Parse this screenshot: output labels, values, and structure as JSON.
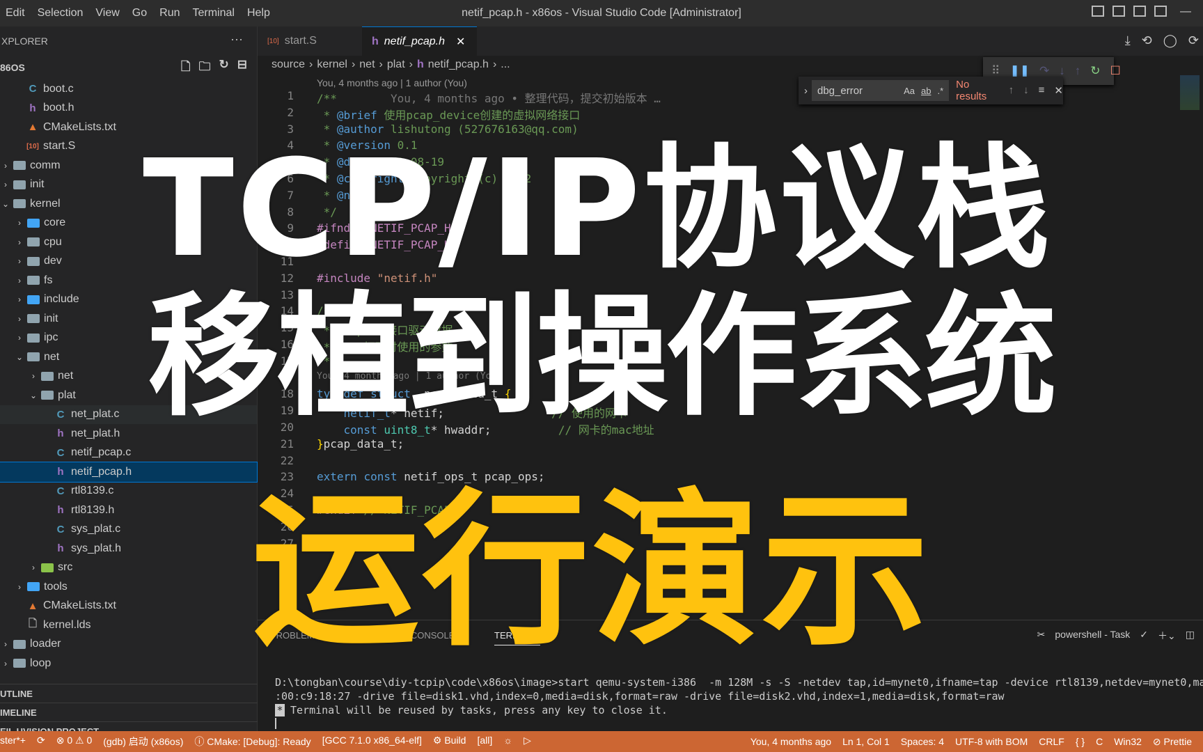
{
  "window": {
    "title": "netif_pcap.h - x86os - Visual Studio Code [Administrator]",
    "menu": [
      "Edit",
      "Selection",
      "View",
      "Go",
      "Run",
      "Terminal",
      "Help"
    ]
  },
  "sidebar": {
    "header": "XPLORER",
    "project": "86OS",
    "items": [
      {
        "label": "boot.c",
        "icon": "c-file-icon",
        "depth": 1
      },
      {
        "label": "boot.h",
        "icon": "h-file-icon",
        "depth": 1
      },
      {
        "label": "CMakeLists.txt",
        "icon": "cmake-icon",
        "depth": 1
      },
      {
        "label": "start.S",
        "icon": "asm-file-icon",
        "depth": 1
      },
      {
        "label": "comm",
        "icon": "folder-icon",
        "depth": 0,
        "chev": "›"
      },
      {
        "label": "init",
        "icon": "folder-icon",
        "depth": 0,
        "chev": "›"
      },
      {
        "label": "kernel",
        "icon": "folder-open-icon",
        "depth": 0,
        "chev": "⌄"
      },
      {
        "label": "core",
        "icon": "folder-blue-icon",
        "depth": 1,
        "chev": "›"
      },
      {
        "label": "cpu",
        "icon": "folder-icon",
        "depth": 1,
        "chev": "›"
      },
      {
        "label": "dev",
        "icon": "folder-icon",
        "depth": 1,
        "chev": "›"
      },
      {
        "label": "fs",
        "icon": "folder-icon",
        "depth": 1,
        "chev": "›"
      },
      {
        "label": "include",
        "icon": "folder-blue-icon",
        "depth": 1,
        "chev": "›"
      },
      {
        "label": "init",
        "icon": "folder-icon",
        "depth": 1,
        "chev": "›"
      },
      {
        "label": "ipc",
        "icon": "folder-icon",
        "depth": 1,
        "chev": "›"
      },
      {
        "label": "net",
        "icon": "folder-open-icon",
        "depth": 1,
        "chev": "⌄"
      },
      {
        "label": "net",
        "icon": "folder-icon",
        "depth": 2,
        "chev": "›"
      },
      {
        "label": "plat",
        "icon": "folder-open-icon",
        "depth": 2,
        "chev": "⌄"
      },
      {
        "label": "net_plat.c",
        "icon": "c-file-icon",
        "depth": 3
      },
      {
        "label": "net_plat.h",
        "icon": "h-file-icon",
        "depth": 3
      },
      {
        "label": "netif_pcap.c",
        "icon": "c-file-icon",
        "depth": 3
      },
      {
        "label": "netif_pcap.h",
        "icon": "h-file-icon",
        "depth": 3,
        "selected": true
      },
      {
        "label": "rtl8139.c",
        "icon": "c-file-icon",
        "depth": 3
      },
      {
        "label": "rtl8139.h",
        "icon": "h-file-icon",
        "depth": 3
      },
      {
        "label": "sys_plat.c",
        "icon": "c-file-icon",
        "depth": 3
      },
      {
        "label": "sys_plat.h",
        "icon": "h-file-icon",
        "depth": 3
      },
      {
        "label": "src",
        "icon": "folder-green-icon",
        "depth": 2,
        "chev": "›"
      },
      {
        "label": "tools",
        "icon": "folder-blue-icon",
        "depth": 1,
        "chev": "›"
      },
      {
        "label": "CMakeLists.txt",
        "icon": "cmake-icon",
        "depth": 1
      },
      {
        "label": "kernel.lds",
        "icon": "ld-file-icon",
        "depth": 1
      },
      {
        "label": "loader",
        "icon": "folder-icon",
        "depth": 0,
        "chev": "›"
      },
      {
        "label": "loop",
        "icon": "folder-icon",
        "depth": 0,
        "chev": "›"
      }
    ],
    "sections": [
      "UTLINE",
      "IMELINE",
      "EIL UVISION PROJECT"
    ]
  },
  "tabs": [
    {
      "label": "start.S",
      "icon": "asm-file-icon"
    },
    {
      "label": "netif_pcap.h",
      "icon": "h-file-icon",
      "active": true,
      "close": "✕"
    }
  ],
  "breadcrumb": [
    "source",
    "kernel",
    "net",
    "plat",
    "netif_pcap.h",
    "..."
  ],
  "blame": "You, 4 months ago | 1 author (You)",
  "code": [
    {
      "n": "1",
      "html": "<span class='cmt'>/**</span>        <span class='gh'>You, 4 months ago • 整理代码，提交初始版本 …</span>"
    },
    {
      "n": "2",
      "html": "<span class='cmt'> * </span><span class='kw'>@brief</span><span class='cmt'> 使用pcap_device创建的虚拟网络接口</span>"
    },
    {
      "n": "3",
      "html": "<span class='cmt'> * </span><span class='kw'>@author</span><span class='cmt'> lishutong (527676163@qq.com)</span>"
    },
    {
      "n": "4",
      "html": "<span class='cmt'> * </span><span class='kw'>@version</span><span class='cmt'> 0.1</span>"
    },
    {
      "n": "5",
      "html": "<span class='cmt'> * </span><span class='kw'>@date</span><span class='cmt'> 2022-08-19</span>"
    },
    {
      "n": "6",
      "html": "<span class='cmt'> * </span><span class='kw'>@copyright</span><span class='cmt'> Copyright (c) 2022</span>"
    },
    {
      "n": "7",
      "html": "<span class='cmt'> * </span><span class='kw'>@note</span>"
    },
    {
      "n": "8",
      "html": "<span class='cmt'> */</span>"
    },
    {
      "n": "9",
      "html": "<span class='mac'>#ifndef</span> <span class='mac'>NETIF_PCAP_H</span>"
    },
    {
      "n": "10",
      "html": "<span class='mac'>#define</span> <span class='mac'>NETIF_PCAP_H</span>"
    },
    {
      "n": "11",
      "html": ""
    },
    {
      "n": "12",
      "html": "<span class='mac'>#include</span> <span class='str'>\"netif.h\"</span>"
    },
    {
      "n": "13",
      "html": ""
    },
    {
      "n": "14",
      "html": "<span class='cmt'>/**</span>"
    },
    {
      "n": "15",
      "html": "<span class='cmt'> * pcap网络接口驱动数据</span>"
    },
    {
      "n": "16",
      "html": "<span class='cmt'> * pcap打开时使用的参数</span>"
    },
    {
      "n": "17",
      "html": "<span class='cmt'> */</span>"
    },
    {
      "n": "",
      "html": "<span class='gh'>You, 4 months ago | 1 author (You)</span>"
    },
    {
      "n": "18",
      "html": "<span class='kw'>typedef</span> <span class='kw'>struct</span> _pcap_data_t <span class='br'>{</span>"
    },
    {
      "n": "19",
      "html": "    <span class='kw'>netif_t</span>* netif;                <span class='cmt'>// 使用的网卡</span>"
    },
    {
      "n": "20",
      "html": "    <span class='kw'>const</span> <span class='typ'>uint8_t</span>* hwaddr;          <span class='cmt'>// 网卡的mac地址</span>"
    },
    {
      "n": "21",
      "html": "<span class='br'>}</span>pcap_data_t;"
    },
    {
      "n": "22",
      "html": ""
    },
    {
      "n": "23",
      "html": "<span class='kw'>extern</span> <span class='kw'>const</span> netif_ops_t pcap_ops;"
    },
    {
      "n": "24",
      "html": ""
    },
    {
      "n": "25",
      "html": "<span class='mac'>#endif</span> <span class='cmt'>// NETIF_PCAP_H</span>"
    },
    {
      "n": "26",
      "html": ""
    },
    {
      "n": "27",
      "html": ""
    }
  ],
  "find": {
    "value": "dbg_error",
    "options": [
      "Aa",
      "ab",
      ".*"
    ],
    "result": "No results"
  },
  "panel": {
    "tabs": [
      "PROBLEMS",
      "DEBUG CONSOLE",
      "TERMINAL"
    ],
    "active": "TERMINAL",
    "task": "powershell - Task",
    "lines": [
      "D:\\tongban\\course\\diy-tcpip\\code\\x86os\\image>start qemu-system-i386  -m 128M -s -S -netdev tap,id=mynet0,ifname=tap -device rtl8139,netdev=mynet0,ma",
      ":00:c9:18:27 -drive file=disk1.vhd,index=0,media=disk,format=raw -drive file=disk2.vhd,index=1,media=disk,format=raw",
      "Terminal will be reused by tasks, press any key to close it."
    ]
  },
  "status": {
    "left": [
      "ster*+",
      "⟳",
      "⊗ 0 ⚠ 0",
      "(gdb) 启动 (x86os)",
      "ⓘ CMake: [Debug]: Ready",
      "[GCC 7.1.0 x86_64-elf]",
      "⚙ Build",
      "[all]",
      "☼",
      "▷"
    ],
    "right": [
      "You, 4 months ago",
      "Ln 1, Col 1",
      "Spaces: 4",
      "UTF-8 with BOM",
      "CRLF",
      "{ }",
      "C",
      "Win32",
      "⊘ Prettie"
    ]
  },
  "overlay": {
    "line1": "TCP/IP协议栈",
    "line2": "移植到操作系统",
    "line3": "运行演示",
    "color_white": "#ffffff",
    "color_yellow": "#ffc20e"
  },
  "colors": {
    "status_bar": "#cc6633",
    "selection": "#04395e"
  }
}
